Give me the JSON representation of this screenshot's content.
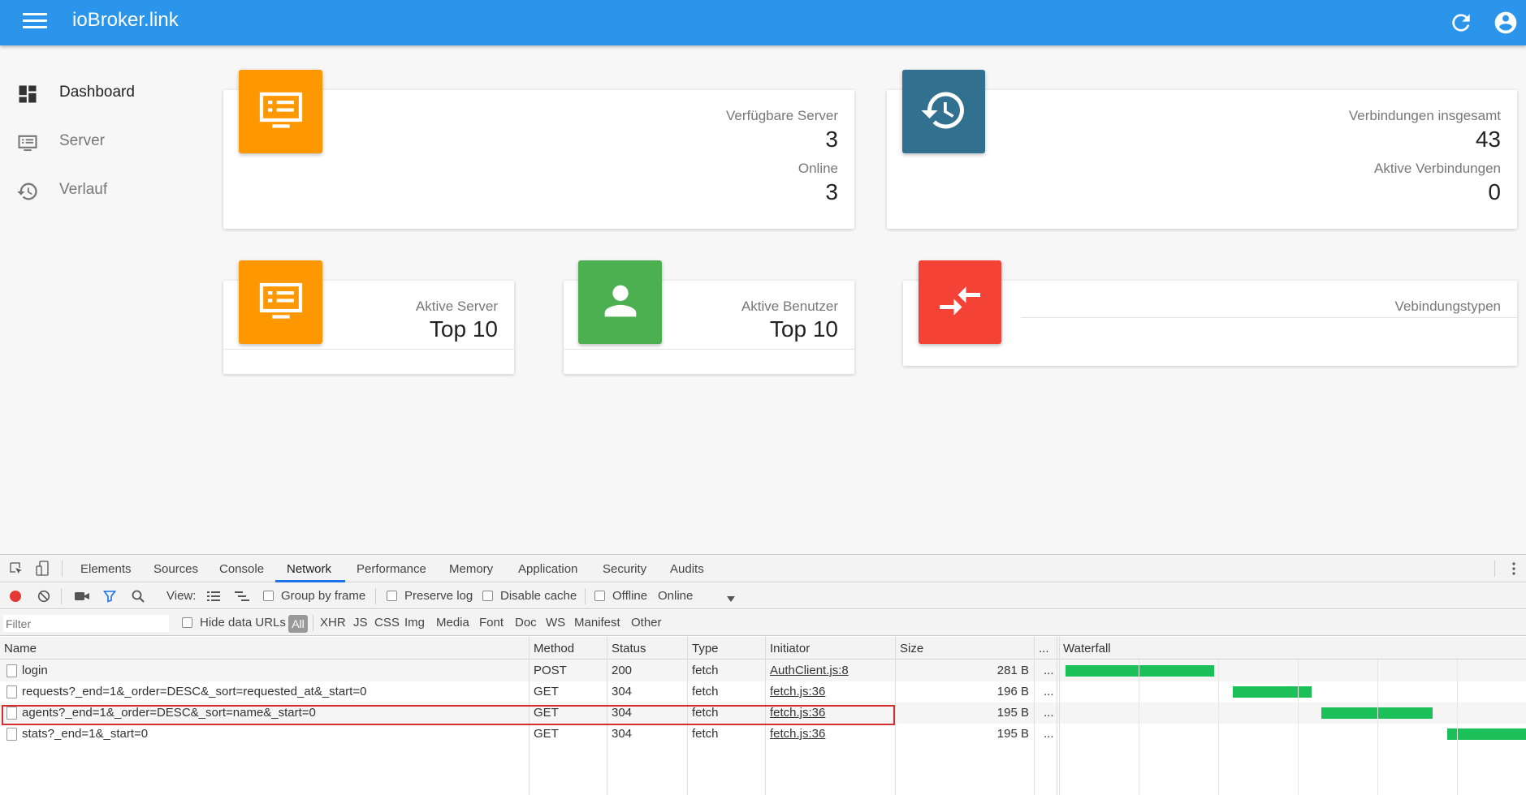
{
  "app": {
    "title": "ioBroker.link"
  },
  "sidebar": {
    "items": [
      {
        "label": "Dashboard",
        "icon": "dashboard-icon"
      },
      {
        "label": "Server",
        "icon": "server-icon"
      },
      {
        "label": "Verlauf",
        "icon": "history-icon"
      }
    ]
  },
  "cards": {
    "servers": {
      "available_label": "Verfügbare Server",
      "available_value": "3",
      "online_label": "Online",
      "online_value": "3",
      "icon": "server-icon",
      "color": "#ff9800"
    },
    "connections": {
      "total_label": "Verbindungen insgesamt",
      "total_value": "43",
      "active_label": "Aktive Verbindungen",
      "active_value": "0",
      "icon": "history-icon",
      "color": "#32708f"
    },
    "active_servers": {
      "label": "Aktive Server",
      "value": "Top 10",
      "icon": "server-icon",
      "color": "#ff9800"
    },
    "active_users": {
      "label": "Aktive Benutzer",
      "value": "Top 10",
      "icon": "person-icon",
      "color": "#4caf50"
    },
    "connection_types": {
      "label": "Vebindungstypen",
      "icon": "compare-arrows-icon",
      "color": "#f44336"
    }
  },
  "devtools": {
    "tabs": [
      "Elements",
      "Sources",
      "Console",
      "Network",
      "Performance",
      "Memory",
      "Application",
      "Security",
      "Audits"
    ],
    "active_tab": "Network",
    "toolbar": {
      "view_label": "View:",
      "group_by_frame": "Group by frame",
      "preserve_log": "Preserve log",
      "disable_cache": "Disable cache",
      "offline": "Offline",
      "throttle": "Online"
    },
    "filter": {
      "placeholder": "Filter",
      "hide_data_urls": "Hide data URLs",
      "types": [
        "All",
        "XHR",
        "JS",
        "CSS",
        "Img",
        "Media",
        "Font",
        "Doc",
        "WS",
        "Manifest",
        "Other"
      ]
    },
    "columns": [
      "Name",
      "Method",
      "Status",
      "Type",
      "Initiator",
      "Size",
      "...",
      "Waterfall"
    ],
    "rows": [
      {
        "name": "login",
        "method": "POST",
        "status": "200",
        "type": "fetch",
        "initiator": "AuthClient.js:8",
        "size": "281 B",
        "more": "...",
        "waterfall_start": 0.01,
        "waterfall_end": 0.33
      },
      {
        "name": "requests?_end=1&_order=DESC&_sort=requested_at&_start=0",
        "method": "GET",
        "status": "304",
        "type": "fetch",
        "initiator": "fetch.js:36",
        "size": "196 B",
        "more": "...",
        "waterfall_start": 0.37,
        "waterfall_end": 0.54
      },
      {
        "name": "agents?_end=1&_order=DESC&_sort=name&_start=0",
        "method": "GET",
        "status": "304",
        "type": "fetch",
        "initiator": "fetch.js:36",
        "size": "195 B",
        "more": "...",
        "waterfall_start": 0.56,
        "waterfall_end": 0.8
      },
      {
        "name": "stats?_end=1&_start=0",
        "method": "GET",
        "status": "304",
        "type": "fetch",
        "initiator": "fetch.js:36",
        "size": "195 B",
        "more": "...",
        "waterfall_start": 0.83,
        "waterfall_end": 1.0
      }
    ],
    "highlighted_row": 2
  },
  "colors": {
    "appbar": "#2a95ea",
    "accent": "#1a73e8",
    "waterfall": "#1bc058",
    "highlight": "#d32f2f"
  }
}
